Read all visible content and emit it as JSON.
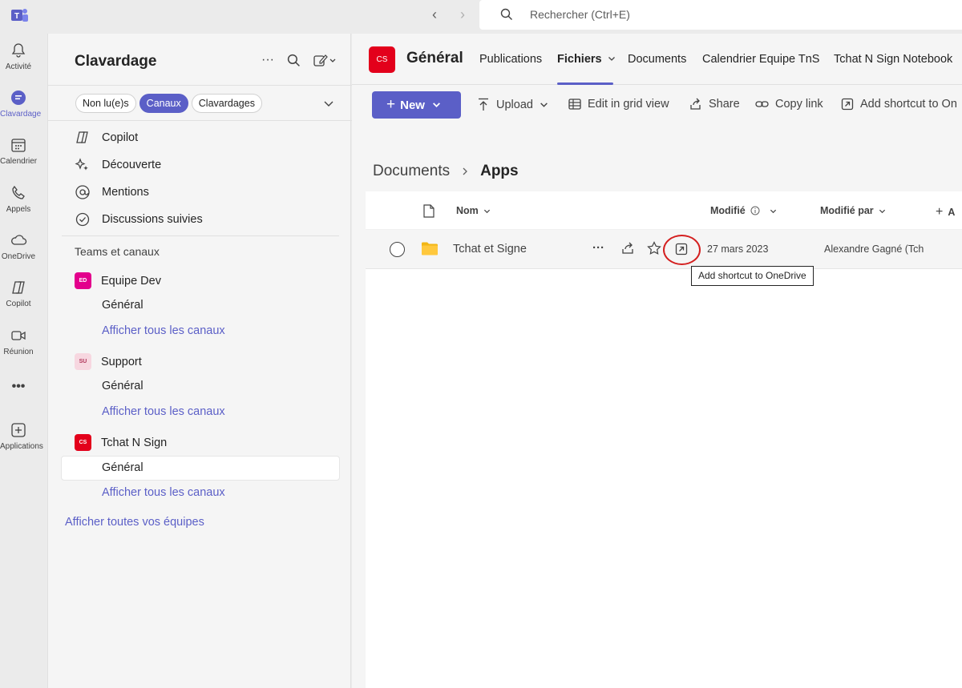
{
  "topbar": {
    "search_placeholder": "Rechercher (Ctrl+E)"
  },
  "rail": [
    {
      "label": "Activité",
      "icon": "bell-icon"
    },
    {
      "label": "Clavardage",
      "icon": "chat-icon",
      "active": true
    },
    {
      "label": "Calendrier",
      "icon": "calendar-icon"
    },
    {
      "label": "Appels",
      "icon": "phone-icon"
    },
    {
      "label": "OneDrive",
      "icon": "cloud-icon"
    },
    {
      "label": "Copilot",
      "icon": "copilot-icon"
    },
    {
      "label": "Réunion",
      "icon": "video-icon"
    },
    {
      "label": "•••",
      "icon": "more-icon"
    },
    {
      "label": "Applications",
      "icon": "add-apps-icon"
    }
  ],
  "panel": {
    "title": "Clavardage",
    "filters": [
      "Non lu(e)s",
      "Canaux",
      "Clavardages"
    ],
    "nav": [
      "Copilot",
      "Découverte",
      "Mentions",
      "Discussions suivies"
    ],
    "section_head": "Teams et canaux",
    "teams": [
      {
        "name": "Equipe Dev",
        "initials": "ED",
        "color": "#e3008c",
        "channel": "Général",
        "more": "Afficher tous les canaux"
      },
      {
        "name": "Support",
        "initials": "SU",
        "color": "#f7d7e0",
        "channel": "Général",
        "more": "Afficher tous les canaux"
      },
      {
        "name": "Tchat N Sign",
        "initials": "CS",
        "color": "#e3001b",
        "channel": "Général",
        "more": "Afficher tous les canaux"
      }
    ],
    "all_teams": "Afficher toutes vos équipes"
  },
  "main": {
    "team_initials": "CS",
    "channel_title": "Général",
    "tabs": [
      "Publications",
      "Fichiers",
      "Documents",
      "Calendrier Equipe TnS",
      "Tchat N Sign Notebook"
    ],
    "toolbar": {
      "new": "New",
      "upload": "Upload",
      "grid": "Edit in grid view",
      "share": "Share",
      "copy": "Copy link",
      "shortcut": "Add shortcut to On"
    },
    "breadcrumb": {
      "root": "Documents",
      "current": "Apps"
    },
    "columns": {
      "name": "Nom",
      "modified": "Modifié",
      "modified_by": "Modifié par",
      "add": "A"
    },
    "row": {
      "name": "Tchat et Signe",
      "modified": "27 mars 2023",
      "modified_by": "Alexandre Gagné (Tch"
    },
    "tooltip": "Add shortcut to OneDrive"
  },
  "colors": {
    "accent": "#5b5fc7",
    "highlight": "#d41f1f"
  }
}
